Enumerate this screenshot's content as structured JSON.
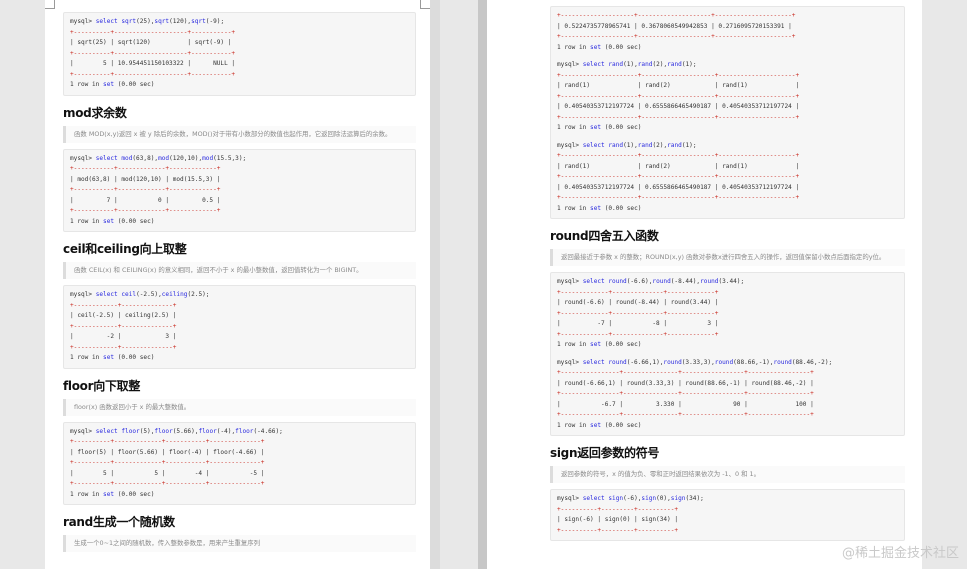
{
  "left": {
    "block_sqrt": [
      {
        "t": "cmd",
        "s": "mysql> select sqrt(25),sqrt(120),sqrt(-9);"
      },
      {
        "t": "sep",
        "s": "+----------+--------------------+-----------+"
      },
      {
        "t": "row",
        "s": "| sqrt(25) | sqrt(120)          | sqrt(-9) |"
      },
      {
        "t": "sep",
        "s": "+----------+--------------------+-----------+"
      },
      {
        "t": "row",
        "s": "|        5 | 10.954451150103322 |      NULL |"
      },
      {
        "t": "sep",
        "s": "+----------+--------------------+-----------+"
      },
      {
        "t": "row",
        "s": "1 row in set (0.00 sec)"
      }
    ],
    "mod_title": "mod求余数",
    "mod_desc": "函数 MOD(x,y)返回 x 被 y 除后的余数，MOD()对于带有小数部分的数值也起作用，它返回除法运算后的余数。",
    "block_mod": [
      {
        "t": "cmd",
        "s": "mysql> select mod(63,8),mod(120,10),mod(15.5,3);"
      },
      {
        "t": "sep",
        "s": "+-----------+-------------+-------------+"
      },
      {
        "t": "row",
        "s": "| mod(63,8) | mod(120,10) | mod(15.5,3) |"
      },
      {
        "t": "sep",
        "s": "+-----------+-------------+-------------+"
      },
      {
        "t": "row",
        "s": "|         7 |           0 |         0.5 |"
      },
      {
        "t": "sep",
        "s": "+-----------+-------------+-------------+"
      },
      {
        "t": "row",
        "s": "1 row in set (0.00 sec)"
      }
    ],
    "ceil_title": "ceil和ceiling向上取整",
    "ceil_desc": "函数 CEIL(x) 和 CEILING(x) 的意义相同，返回不小于 x 的最小整数值，返回值转化为一个 BIGINT。",
    "block_ceil": [
      {
        "t": "cmd",
        "s": "mysql> select ceil(-2.5),ceiling(2.5);"
      },
      {
        "t": "sep",
        "s": "+------------+--------------+"
      },
      {
        "t": "row",
        "s": "| ceil(-2.5) | ceiling(2.5) |"
      },
      {
        "t": "sep",
        "s": "+------------+--------------+"
      },
      {
        "t": "row",
        "s": "|         -2 |            3 |"
      },
      {
        "t": "sep",
        "s": "+------------+--------------+"
      },
      {
        "t": "row",
        "s": "1 row in set (0.00 sec)"
      }
    ],
    "floor_title": "floor向下取整",
    "floor_desc": "floor(x) 函数返回小于 x 的最大整数值。",
    "block_floor": [
      {
        "t": "cmd",
        "s": "mysql> select floor(5),floor(5.66),floor(-4),floor(-4.66);"
      },
      {
        "t": "sep",
        "s": "+----------+-------------+-----------+--------------+"
      },
      {
        "t": "row",
        "s": "| floor(5) | floor(5.66) | floor(-4) | floor(-4.66) |"
      },
      {
        "t": "sep",
        "s": "+----------+-------------+-----------+--------------+"
      },
      {
        "t": "row",
        "s": "|        5 |           5 |        -4 |           -5 |"
      },
      {
        "t": "sep",
        "s": "+----------+-------------+-----------+--------------+"
      },
      {
        "t": "row",
        "s": "1 row in set (0.00 sec)"
      }
    ],
    "rand_title": "rand生成一个随机数",
    "rand_desc": "生成一个0~1之间的随机数，传入整数参数是，用来产生重复序列"
  },
  "right": {
    "block_rand0": [
      {
        "t": "sep",
        "s": "+--------------------+--------------------+---------------------+"
      },
      {
        "t": "row",
        "s": "| 0.5224735778965741 | 0.3678060549942853 | 0.2716095720153391 |"
      },
      {
        "t": "sep",
        "s": "+--------------------+--------------------+---------------------+"
      },
      {
        "t": "row",
        "s": "1 row in set (0.00 sec)"
      },
      {
        "t": "blank",
        "s": ""
      },
      {
        "t": "cmd",
        "s": "mysql> select rand(1),rand(2),rand(1);"
      },
      {
        "t": "sep",
        "s": "+---------------------+--------------------+---------------------+"
      },
      {
        "t": "row",
        "s": "| rand(1)             | rand(2)            | rand(1)             |"
      },
      {
        "t": "sep",
        "s": "+---------------------+--------------------+---------------------+"
      },
      {
        "t": "row",
        "s": "| 0.40540353712197724 | 0.6555866465490187 | 0.40540353712197724 |"
      },
      {
        "t": "sep",
        "s": "+---------------------+--------------------+---------------------+"
      },
      {
        "t": "row",
        "s": "1 row in set (0.00 sec)"
      },
      {
        "t": "blank",
        "s": ""
      },
      {
        "t": "cmd",
        "s": "mysql> select rand(1),rand(2),rand(1);"
      },
      {
        "t": "sep",
        "s": "+---------------------+--------------------+---------------------+"
      },
      {
        "t": "row",
        "s": "| rand(1)             | rand(2)            | rand(1)             |"
      },
      {
        "t": "sep",
        "s": "+---------------------+--------------------+---------------------+"
      },
      {
        "t": "row",
        "s": "| 0.40540353712197724 | 0.6555866465490187 | 0.40540353712197724 |"
      },
      {
        "t": "sep",
        "s": "+---------------------+--------------------+---------------------+"
      },
      {
        "t": "row",
        "s": "1 row in set (0.00 sec)"
      }
    ],
    "round_title": "round四舍五入函数",
    "round_desc": "返回最接近于参数 x 的整数；ROUND(x,y) 函数对参数x进行四舍五入的操作，返回值保留小数点后面指定的y位。",
    "block_round": [
      {
        "t": "cmd",
        "s": "mysql> select round(-6.6),round(-8.44),round(3.44);"
      },
      {
        "t": "sep",
        "s": "+-------------+--------------+-------------+"
      },
      {
        "t": "row",
        "s": "| round(-6.6) | round(-8.44) | round(3.44) |"
      },
      {
        "t": "sep",
        "s": "+-------------+--------------+-------------+"
      },
      {
        "t": "row",
        "s": "|          -7 |           -8 |           3 |"
      },
      {
        "t": "sep",
        "s": "+-------------+--------------+-------------+"
      },
      {
        "t": "row",
        "s": "1 row in set (0.00 sec)"
      },
      {
        "t": "blank",
        "s": ""
      },
      {
        "t": "cmd",
        "s": "mysql> select round(-6.66,1),round(3.33,3),round(88.66,-1),round(88.46,-2);"
      },
      {
        "t": "sep",
        "s": "+----------------+---------------+-----------------+-----------------+"
      },
      {
        "t": "row",
        "s": "| round(-6.66,1) | round(3.33,3) | round(88.66,-1) | round(88.46,-2) |"
      },
      {
        "t": "sep",
        "s": "+----------------+---------------+-----------------+-----------------+"
      },
      {
        "t": "row",
        "s": "|           -6.7 |         3.330 |              90 |             100 |"
      },
      {
        "t": "sep",
        "s": "+----------------+---------------+-----------------+-----------------+"
      },
      {
        "t": "row",
        "s": "1 row in set (0.00 sec)"
      }
    ],
    "sign_title": "sign返回参数的符号",
    "sign_desc": "返回参数的符号，x 的值为负、零和正时返回结果依次为 -1、0 和 1。",
    "block_sign": [
      {
        "t": "cmd",
        "s": "mysql> select sign(-6),sign(0),sign(34);"
      },
      {
        "t": "sep",
        "s": "+----------+---------+----------+"
      },
      {
        "t": "row",
        "s": "| sign(-6) | sign(0) | sign(34) |"
      },
      {
        "t": "sep",
        "s": "+----------+---------+----------+"
      }
    ]
  },
  "watermark": "@稀土掘金技术社区"
}
